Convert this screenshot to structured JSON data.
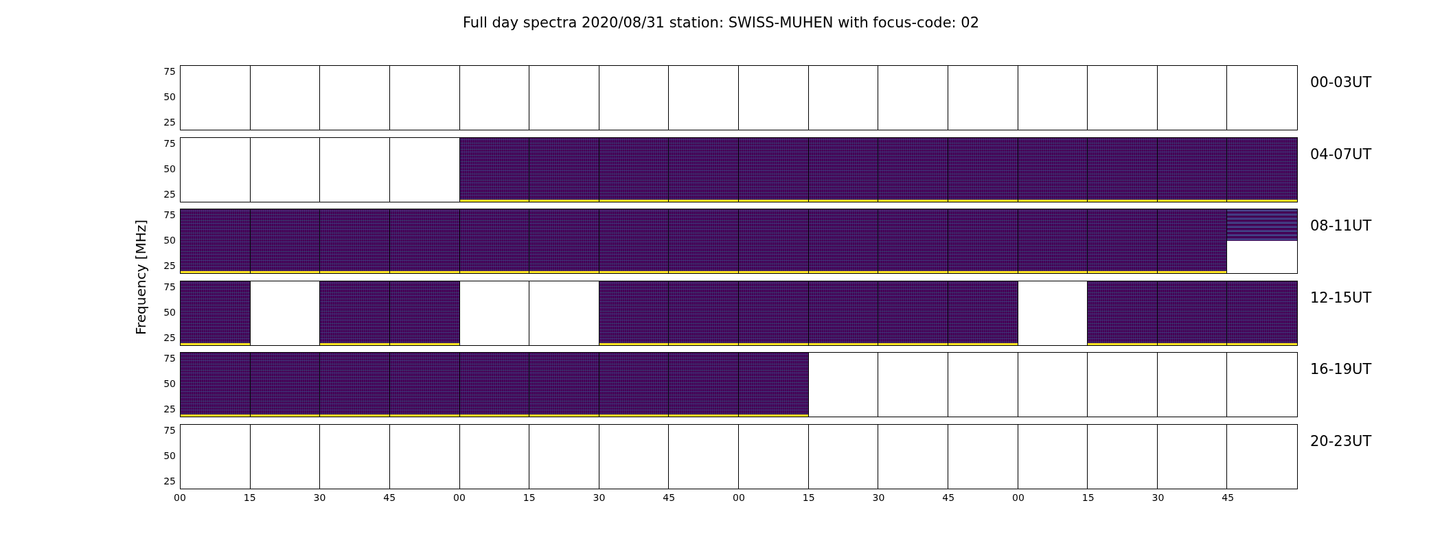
{
  "title": "Full day spectra 2020/08/31 station: SWISS-MUHEN with focus-code: 02",
  "ylabel": "Frequency [MHz]",
  "rows": [
    {
      "label": "00-03UT",
      "yticks": [
        "75",
        "50",
        "25"
      ],
      "panels": [
        {
          "kind": "empty"
        },
        {
          "kind": "empty"
        },
        {
          "kind": "empty"
        },
        {
          "kind": "empty"
        },
        {
          "kind": "empty"
        },
        {
          "kind": "empty"
        },
        {
          "kind": "empty"
        },
        {
          "kind": "empty"
        },
        {
          "kind": "empty"
        },
        {
          "kind": "empty"
        },
        {
          "kind": "empty"
        },
        {
          "kind": "empty"
        },
        {
          "kind": "empty"
        },
        {
          "kind": "empty"
        },
        {
          "kind": "empty"
        },
        {
          "kind": "empty"
        }
      ]
    },
    {
      "label": "04-07UT",
      "yticks": [
        "75",
        "50",
        "25"
      ],
      "panels": [
        {
          "kind": "empty"
        },
        {
          "kind": "empty"
        },
        {
          "kind": "empty"
        },
        {
          "kind": "empty"
        },
        {
          "kind": "spectrum"
        },
        {
          "kind": "spectrum"
        },
        {
          "kind": "spectrum"
        },
        {
          "kind": "spectrum"
        },
        {
          "kind": "spectrum"
        },
        {
          "kind": "spectrum"
        },
        {
          "kind": "spectrum"
        },
        {
          "kind": "spectrum"
        },
        {
          "kind": "spectrum"
        },
        {
          "kind": "spectrum"
        },
        {
          "kind": "spectrum"
        },
        {
          "kind": "spectrum"
        }
      ]
    },
    {
      "label": "08-11UT",
      "yticks": [
        "75",
        "50",
        "25"
      ],
      "panels": [
        {
          "kind": "spectrum"
        },
        {
          "kind": "spectrum"
        },
        {
          "kind": "spectrum"
        },
        {
          "kind": "spectrum"
        },
        {
          "kind": "spectrum"
        },
        {
          "kind": "spectrum"
        },
        {
          "kind": "spectrum"
        },
        {
          "kind": "spectrum"
        },
        {
          "kind": "spectrum"
        },
        {
          "kind": "spectrum"
        },
        {
          "kind": "spectrum"
        },
        {
          "kind": "spectrum"
        },
        {
          "kind": "spectrum"
        },
        {
          "kind": "spectrum"
        },
        {
          "kind": "spectrum"
        },
        {
          "kind": "partial"
        }
      ]
    },
    {
      "label": "12-15UT",
      "yticks": [
        "75",
        "50",
        "25"
      ],
      "panels": [
        {
          "kind": "spectrum"
        },
        {
          "kind": "empty"
        },
        {
          "kind": "spectrum"
        },
        {
          "kind": "spectrum"
        },
        {
          "kind": "empty"
        },
        {
          "kind": "empty"
        },
        {
          "kind": "spectrum"
        },
        {
          "kind": "spectrum"
        },
        {
          "kind": "spectrum"
        },
        {
          "kind": "spectrum"
        },
        {
          "kind": "spectrum"
        },
        {
          "kind": "spectrum"
        },
        {
          "kind": "empty"
        },
        {
          "kind": "spectrum"
        },
        {
          "kind": "spectrum"
        },
        {
          "kind": "spectrum"
        }
      ]
    },
    {
      "label": "16-19UT",
      "yticks": [
        "75",
        "50",
        "25"
      ],
      "panels": [
        {
          "kind": "spectrum"
        },
        {
          "kind": "spectrum"
        },
        {
          "kind": "spectrum"
        },
        {
          "kind": "spectrum"
        },
        {
          "kind": "spectrum"
        },
        {
          "kind": "spectrum"
        },
        {
          "kind": "spectrum"
        },
        {
          "kind": "spectrum"
        },
        {
          "kind": "spectrum"
        },
        {
          "kind": "empty"
        },
        {
          "kind": "empty"
        },
        {
          "kind": "empty"
        },
        {
          "kind": "empty"
        },
        {
          "kind": "empty"
        },
        {
          "kind": "empty"
        },
        {
          "kind": "empty"
        }
      ]
    },
    {
      "label": "20-23UT",
      "yticks": [
        "75",
        "50",
        "25"
      ],
      "panels": [
        {
          "kind": "empty"
        },
        {
          "kind": "empty"
        },
        {
          "kind": "empty"
        },
        {
          "kind": "empty"
        },
        {
          "kind": "empty"
        },
        {
          "kind": "empty"
        },
        {
          "kind": "empty"
        },
        {
          "kind": "empty"
        },
        {
          "kind": "empty"
        },
        {
          "kind": "empty"
        },
        {
          "kind": "empty"
        },
        {
          "kind": "empty"
        },
        {
          "kind": "empty"
        },
        {
          "kind": "empty"
        },
        {
          "kind": "empty"
        },
        {
          "kind": "empty"
        }
      ]
    }
  ],
  "xticks": [
    "00",
    "15",
    "30",
    "45",
    "00",
    "15",
    "30",
    "45",
    "00",
    "15",
    "30",
    "45",
    "00",
    "15",
    "30",
    "45"
  ]
}
